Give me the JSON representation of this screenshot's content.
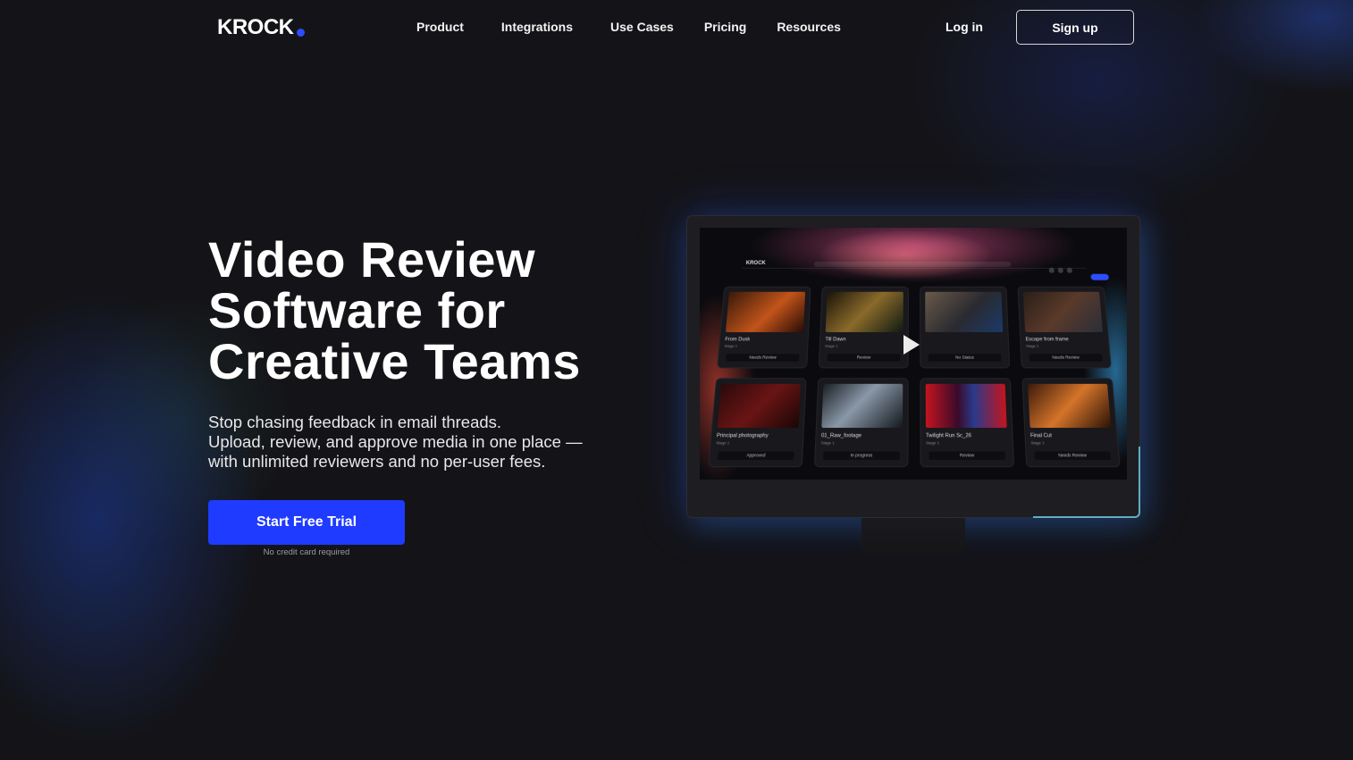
{
  "nav": {
    "logo": "KROCK",
    "links": [
      "Product",
      "Integrations",
      "Use Cases",
      "Pricing",
      "Resources"
    ],
    "login": "Log in",
    "signup": "Sign up"
  },
  "hero": {
    "headline": [
      "Video Review",
      "Software for",
      "Creative Teams"
    ],
    "subtitle": [
      "Stop chasing feedback in email threads.",
      "Upload, review, and approve media in one place —",
      "with unlimited reviewers and no per-user fees."
    ],
    "cta": "Start Free Trial",
    "cta_note": "No credit card required"
  },
  "preview": {
    "app_logo": "KROCK",
    "cards": [
      {
        "title": "From Dusk",
        "meta": "Stage 1",
        "status": "Needs Review"
      },
      {
        "title": "Till Dawn",
        "meta": "Stage 1",
        "status": "Review"
      },
      {
        "title": "",
        "meta": "",
        "status": "No Status"
      },
      {
        "title": "Escape from frame",
        "meta": "Stage 1",
        "status": "Needs Review"
      },
      {
        "title": "Principal photography",
        "meta": "Stage 1",
        "status": "Approved"
      },
      {
        "title": "01_Raw_footage",
        "meta": "Stage 1",
        "status": "In progress"
      },
      {
        "title": "Twilight Run Sc_26",
        "meta": "Stage 1",
        "status": "Review"
      },
      {
        "title": "Final Cut",
        "meta": "Stage 1",
        "status": "Needs Review"
      }
    ]
  },
  "colors": {
    "background": "#141418",
    "accent": "#1f3bff",
    "text": "#ffffff"
  }
}
